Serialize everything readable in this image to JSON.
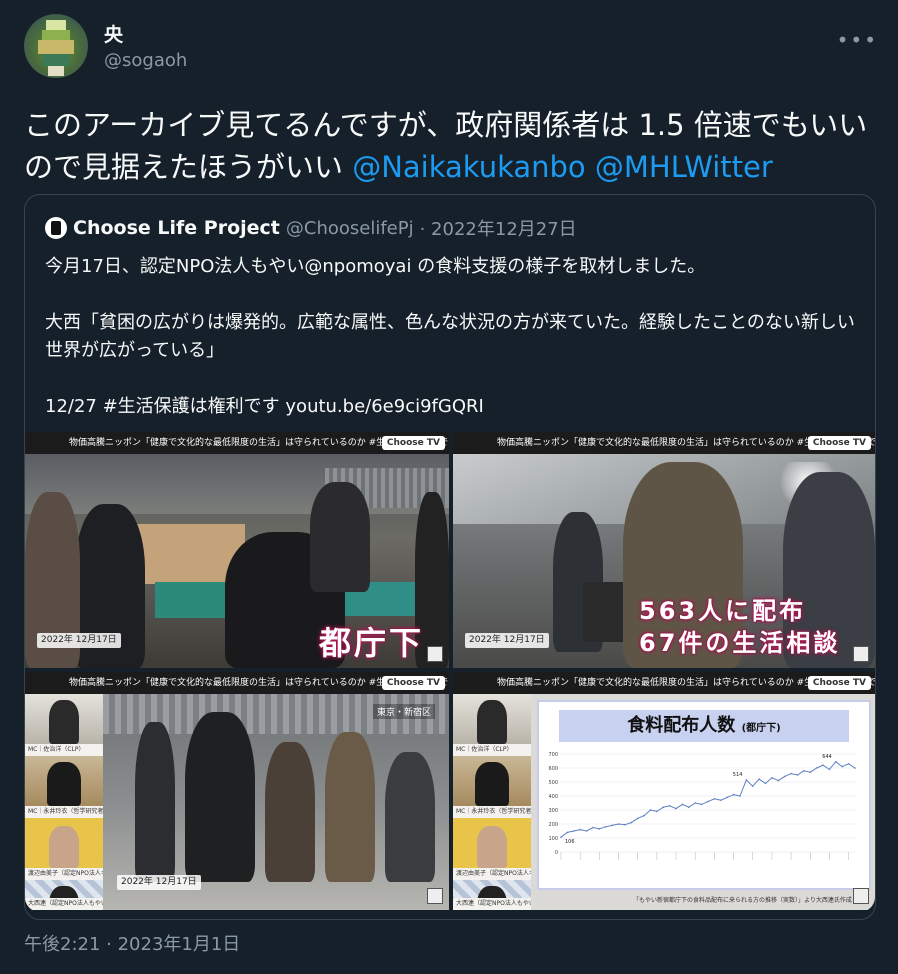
{
  "tweet": {
    "display_name": "央",
    "handle": "@sogaoh",
    "more_icon": "more-horizontal-icon",
    "text_main": "このアーカイブ見てるんですが、政府関係者は 1.5 倍速でもいいので見据えたほうがいい ",
    "mention_1": "@Naikakukanbo",
    "mention_2": "@MHLWitter",
    "timestamp": "午後2:21 · 2023年1月1日"
  },
  "quoted": {
    "name": "Choose Life Project",
    "handle": "@ChooselifePj",
    "date": "· 2022年12月27日",
    "body": "今月17日、認定NPO法人もやい@npomoyai の食料支援の様子を取材しました。\n\n大西「貧困の広がりは爆発的。広範な属性、色んな状況の方が来ていた。経験したことのない新しい世界が広がっている」\n\n12/27 #生活保護は権利です youtu.be/6e9ci9fGQRI"
  },
  "media": {
    "banner": "物価高騰ニッポン「健康で文化的な最低限度の生活」は守られているのか #生活保護は権利です",
    "badge": "Choose TV",
    "cells": [
      {
        "caption": "都庁下",
        "date_tag": "2022年 12月17日"
      },
      {
        "caption_line1": "563人に配布",
        "caption_line2": "67件の生活相談",
        "date_tag": "2022年 12月17日"
      },
      {
        "location": "東京・新宿区",
        "date_tag": "2022年 12月17日",
        "panel_labels": [
          "MC｜佐治洋（CLP）",
          "MC｜永井玲衣（哲学研究者）",
          "渡辺由美子（認定NPO法人キッズ…",
          "大西連（認定NPO法人もやい・理…"
        ]
      },
      {
        "chart_title": "食料配布人数",
        "chart_subtitle": "(都庁下)",
        "panel_labels": [
          "MC｜佐治洋（CLP）",
          "MC｜永井玲衣（哲学研究者）",
          "渡辺由美子（認定NPO法人キッズ…",
          "大西連（認定NPO法人もやい・理…"
        ],
        "source_note": "「もやい新宿都庁下の食料品配布に来られる方の推移（実数）」より大西連氏作成"
      }
    ]
  },
  "chart_data": {
    "type": "line",
    "title": "食料配布人数",
    "subtitle": "(都庁下)",
    "ylim": [
      0,
      700
    ],
    "yticks": [
      0,
      100,
      200,
      300,
      400,
      500,
      600,
      700
    ],
    "annotations": [
      {
        "label": "514",
        "value": 514
      },
      {
        "label": "644",
        "value": 644
      },
      {
        "label": "106",
        "value": 106
      }
    ],
    "series": [
      {
        "values": [
          106,
          140,
          150,
          160,
          150,
          175,
          165,
          180,
          190,
          200,
          195,
          210,
          240,
          260,
          300,
          290,
          320,
          330,
          310,
          340,
          320,
          350,
          340,
          360,
          380,
          370,
          390,
          410,
          400,
          514,
          470,
          520,
          490,
          530,
          510,
          540,
          560,
          550,
          580,
          570,
          600,
          620,
          590,
          644,
          610,
          630,
          600
        ]
      }
    ]
  }
}
